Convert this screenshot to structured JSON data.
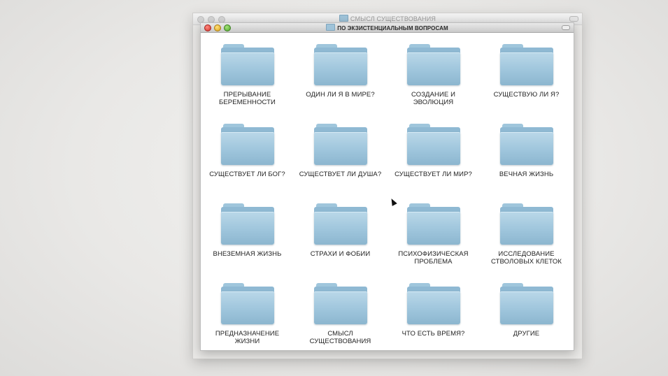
{
  "back_window": {
    "title": "СМЫСЛ СУЩЕСТВОВАНИЯ"
  },
  "front_window": {
    "title": "ПО ЭКЗИСТЕНЦИАЛЬНЫМ ВОПРОСАМ"
  },
  "folders": [
    {
      "label": "ПРЕРЫВАНИЕ\nБЕРЕМЕННОСТИ"
    },
    {
      "label": "ОДИН ЛИ Я В МИРЕ?"
    },
    {
      "label": "СОЗДАНИЕ И\nЭВОЛЮЦИЯ"
    },
    {
      "label": "СУЩЕСТВУЮ ЛИ Я?"
    },
    {
      "label": "СУЩЕСТВУЕТ ЛИ БОГ?"
    },
    {
      "label": "СУЩЕСТВУЕТ ЛИ ДУША?"
    },
    {
      "label": "СУЩЕСТВУЕТ ЛИ МИР?"
    },
    {
      "label": "ВЕЧНАЯ ЖИЗНЬ"
    },
    {
      "label": "ВНЕЗЕМНАЯ ЖИЗНЬ"
    },
    {
      "label": "СТРАХИ И ФОБИИ"
    },
    {
      "label": "ПСИХОФИЗИЧЕСКАЯ\nПРОБЛЕМА"
    },
    {
      "label": "ИССЛЕДОВАНИЕ\nСТВОЛОВЫХ КЛЕТОК"
    },
    {
      "label": "ПРЕДНАЗНАЧЕНИЕ\nЖИЗНИ"
    },
    {
      "label": "СМЫСЛ\nСУЩЕСТВОВАНИЯ"
    },
    {
      "label": "ЧТО ЕСТЬ ВРЕМЯ?"
    },
    {
      "label": "ДРУГИЕ"
    }
  ],
  "icons": {
    "folder": "folder-icon",
    "cursor": "mouse-pointer-icon"
  }
}
